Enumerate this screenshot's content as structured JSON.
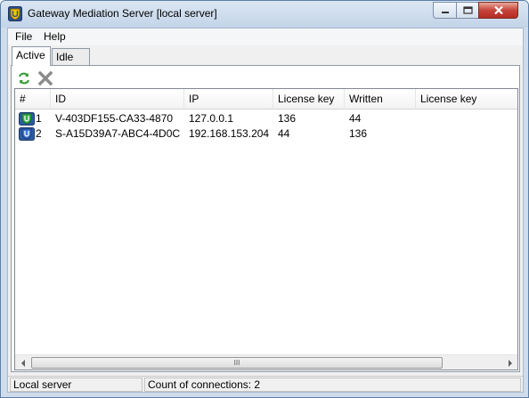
{
  "window": {
    "title": "Gateway Mediation Server [local server]"
  },
  "menu": {
    "items": [
      "File",
      "Help"
    ]
  },
  "tabs": [
    {
      "label": "Active",
      "active": true
    },
    {
      "label": "Idle",
      "active": false
    }
  ],
  "toolbar": {
    "icons": [
      "refresh-icon",
      "delete-icon"
    ]
  },
  "table": {
    "columns": [
      "#",
      "ID",
      "IP",
      "License key",
      "Written",
      "License key"
    ],
    "rows": [
      {
        "num": "1",
        "id": "V-403DF155-CA33-4870",
        "ip": "127.0.0.1",
        "license_key": "136",
        "written": "44",
        "icon": "connection-icon-up"
      },
      {
        "num": "2",
        "id": "S-A15D39A7-ABC4-4D0C",
        "ip": "192.168.153.204",
        "license_key": "44",
        "written": "136",
        "icon": "connection-icon-down"
      }
    ]
  },
  "scrollbar": {
    "grip": "III"
  },
  "status": {
    "location": "Local server",
    "connections": "Count of connections: 2"
  }
}
